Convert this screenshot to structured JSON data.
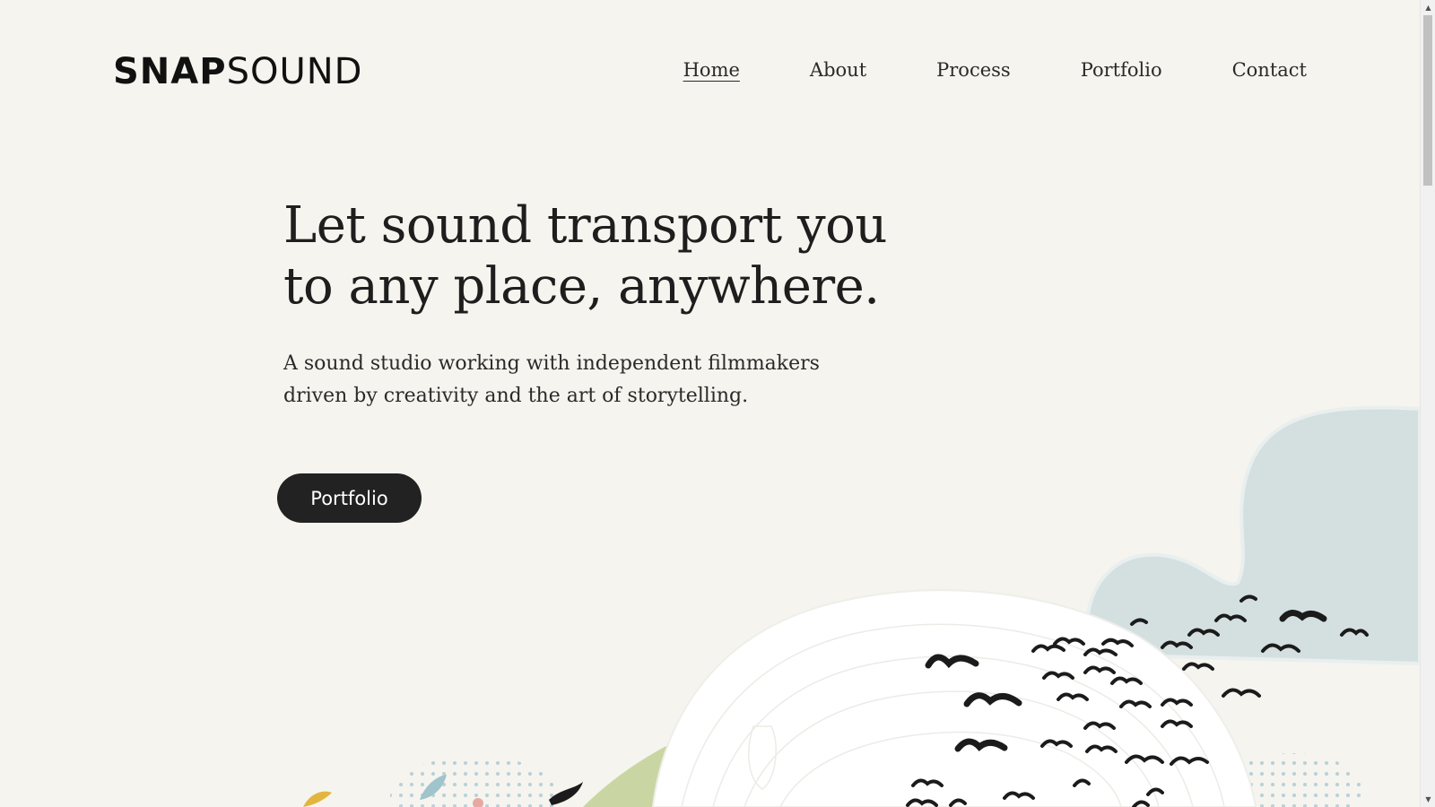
{
  "header": {
    "logo_bold": "SNAP",
    "logo_light": "SOUND",
    "nav": [
      {
        "label": "Home",
        "active": true
      },
      {
        "label": "About",
        "active": false
      },
      {
        "label": "Process",
        "active": false
      },
      {
        "label": "Portfolio",
        "active": false
      },
      {
        "label": "Contact",
        "active": false
      }
    ]
  },
  "hero": {
    "title_line1": "Let sound transport you",
    "title_line2": "to any place, anywhere.",
    "subtitle_line1": "A sound studio working with independent filmmakers",
    "subtitle_line2": "driven by creativity and the art of storytelling.",
    "button_label": "Portfolio"
  },
  "colors": {
    "background": "#f5f4ee",
    "button": "#222222",
    "cloud_blue": "#d4e0e0",
    "hill_green": "#c9d6a3",
    "bird": "#1b1b1b"
  },
  "icons": {
    "scroll_up": "scroll-up-arrow-icon",
    "scroll_down": "scroll-down-arrow-icon"
  }
}
